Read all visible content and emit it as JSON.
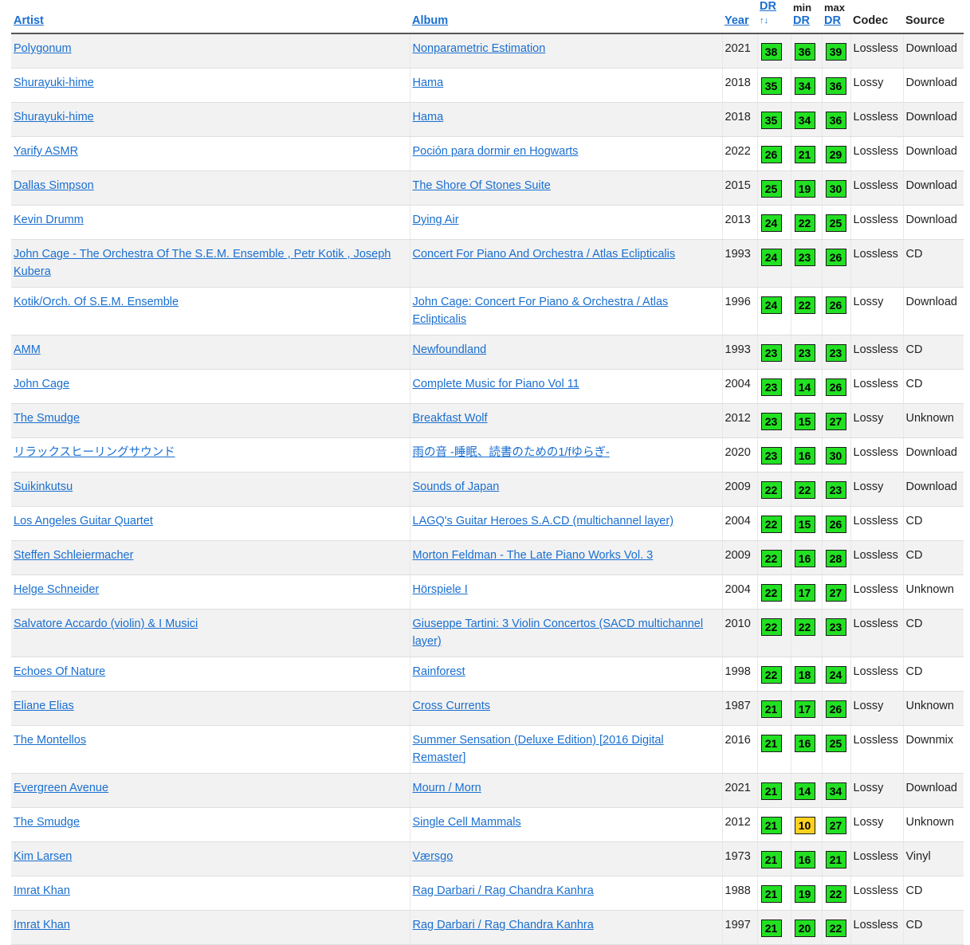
{
  "headers": {
    "artist": "Artist",
    "album": "Album",
    "year": "Year",
    "dr_top": "DR",
    "dr_sort": "↑↓",
    "min_top": "min",
    "min_bottom": "DR",
    "max_top": "max",
    "max_bottom": "DR",
    "codec": "Codec",
    "source": "Source"
  },
  "colors": {
    "link": "#1a6fd0",
    "badge_green": "#22e022",
    "badge_yellow": "#ffd21e"
  },
  "rows": [
    {
      "artist": "Polygonum",
      "album": "Nonparametric Estimation",
      "year": "2021",
      "dr": 38,
      "min": 36,
      "max": 39,
      "codec": "Lossless",
      "source": "Download"
    },
    {
      "artist": "Shurayuki-hime",
      "album": "Hama",
      "year": "2018",
      "dr": 35,
      "min": 34,
      "max": 36,
      "codec": "Lossy",
      "source": "Download"
    },
    {
      "artist": "Shurayuki-hime",
      "album": "Hama",
      "year": "2018",
      "dr": 35,
      "min": 34,
      "max": 36,
      "codec": "Lossless",
      "source": "Download"
    },
    {
      "artist": "Yarify ASMR",
      "album": "Poción para dormir en Hogwarts",
      "year": "2022",
      "dr": 26,
      "min": 21,
      "max": 29,
      "codec": "Lossless",
      "source": "Download"
    },
    {
      "artist": "Dallas Simpson",
      "album": "The Shore Of Stones Suite",
      "year": "2015",
      "dr": 25,
      "min": 19,
      "max": 30,
      "codec": "Lossless",
      "source": "Download"
    },
    {
      "artist": "Kevin Drumm",
      "album": "Dying Air",
      "year": "2013",
      "dr": 24,
      "min": 22,
      "max": 25,
      "codec": "Lossless",
      "source": "Download"
    },
    {
      "artist": "John Cage - The Orchestra Of The S.E.M. Ensemble , Petr Kotik , Joseph Kubera",
      "album": "Concert For Piano And Orchestra / Atlas Eclipticalis",
      "year": "1993",
      "dr": 24,
      "min": 23,
      "max": 26,
      "codec": "Lossless",
      "source": "CD"
    },
    {
      "artist": "Kotik/Orch. Of S.E.M. Ensemble",
      "album": "John Cage: Concert For Piano & Orchestra / Atlas Eclipticalis",
      "year": "1996",
      "dr": 24,
      "min": 22,
      "max": 26,
      "codec": "Lossy",
      "source": "Download"
    },
    {
      "artist": "AMM",
      "album": "Newfoundland",
      "year": "1993",
      "dr": 23,
      "min": 23,
      "max": 23,
      "codec": "Lossless",
      "source": "CD"
    },
    {
      "artist": "John Cage",
      "album": "Complete Music for Piano Vol 11",
      "year": "2004",
      "dr": 23,
      "min": 14,
      "max": 26,
      "codec": "Lossless",
      "source": "CD"
    },
    {
      "artist": "The Smudge",
      "album": "Breakfast Wolf",
      "year": "2012",
      "dr": 23,
      "min": 15,
      "max": 27,
      "codec": "Lossy",
      "source": "Unknown"
    },
    {
      "artist": "リラックスヒーリングサウンド",
      "album": "雨の音 -睡眠、読書のための1/fゆらぎ-",
      "year": "2020",
      "dr": 23,
      "min": 16,
      "max": 30,
      "codec": "Lossless",
      "source": "Download"
    },
    {
      "artist": "Suikinkutsu",
      "album": "Sounds of Japan",
      "year": "2009",
      "dr": 22,
      "min": 22,
      "max": 23,
      "codec": "Lossy",
      "source": "Download"
    },
    {
      "artist": "Los Angeles Guitar Quartet",
      "album": "LAGQ's Guitar Heroes S.A.CD (multichannel layer)",
      "year": "2004",
      "dr": 22,
      "min": 15,
      "max": 26,
      "codec": "Lossless",
      "source": "CD"
    },
    {
      "artist": "Steffen Schleiermacher",
      "album": "Morton Feldman - The Late Piano Works Vol. 3",
      "year": "2009",
      "dr": 22,
      "min": 16,
      "max": 28,
      "codec": "Lossless",
      "source": "CD"
    },
    {
      "artist": "Helge Schneider",
      "album": "Hörspiele I",
      "year": "2004",
      "dr": 22,
      "min": 17,
      "max": 27,
      "codec": "Lossless",
      "source": "Unknown"
    },
    {
      "artist": "Salvatore Accardo (violin) & I Musici",
      "album": "Giuseppe Tartini: 3 Violin Concertos (SACD multichannel layer)",
      "year": "2010",
      "dr": 22,
      "min": 22,
      "max": 23,
      "codec": "Lossless",
      "source": "CD"
    },
    {
      "artist": "Echoes Of Nature",
      "album": "Rainforest",
      "year": "1998",
      "dr": 22,
      "min": 18,
      "max": 24,
      "codec": "Lossless",
      "source": "CD"
    },
    {
      "artist": "Eliane Elias",
      "album": "Cross Currents",
      "year": "1987",
      "dr": 21,
      "min": 17,
      "max": 26,
      "codec": "Lossy",
      "source": "Unknown"
    },
    {
      "artist": "The Montellos",
      "album": "Summer Sensation (Deluxe Edition) [2016 Digital Remaster]",
      "year": "2016",
      "dr": 21,
      "min": 16,
      "max": 25,
      "codec": "Lossless",
      "source": "Downmix"
    },
    {
      "artist": "Evergreen Avenue",
      "album": "Mourn / Morn",
      "year": "2021",
      "dr": 21,
      "min": 14,
      "max": 34,
      "codec": "Lossy",
      "source": "Download"
    },
    {
      "artist": "The Smudge",
      "album": "Single Cell Mammals",
      "year": "2012",
      "dr": 21,
      "min": 10,
      "max": 27,
      "codec": "Lossy",
      "source": "Unknown"
    },
    {
      "artist": "Kim Larsen",
      "album": "Værsgo",
      "year": "1973",
      "dr": 21,
      "min": 16,
      "max": 21,
      "codec": "Lossless",
      "source": "Vinyl"
    },
    {
      "artist": "Imrat Khan",
      "album": "Rag Darbari / Rag Chandra Kanhra",
      "year": "1988",
      "dr": 21,
      "min": 19,
      "max": 22,
      "codec": "Lossless",
      "source": "CD"
    },
    {
      "artist": "Imrat Khan",
      "album": "Rag Darbari / Rag Chandra Kanhra",
      "year": "1997",
      "dr": 21,
      "min": 20,
      "max": 22,
      "codec": "Lossless",
      "source": "CD"
    }
  ]
}
